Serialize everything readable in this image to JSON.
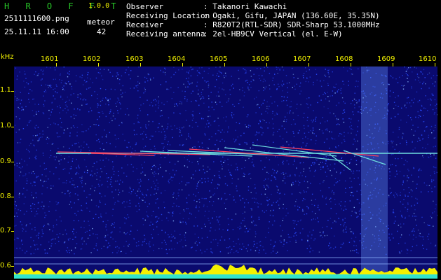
{
  "header": {
    "app_title": "H R O F F T",
    "app_version": "1.0.0",
    "file_name": "2511111600.png",
    "timestamp": "25.11.11 16:00",
    "meteor_label": "meteor",
    "meteor_count": "42",
    "info": [
      {
        "key": "Observer",
        "value": ": Takanori Kawachi"
      },
      {
        "key": "Receiving Location",
        "value": ": Ogaki, Gifu, JAPAN (136.60E, 35.35N)"
      },
      {
        "key": "Receiver",
        "value": ": R820T2(RTL-SDR) SDR-Sharp 53.1000MHz"
      },
      {
        "key": "Receiving antenna",
        "value": ": 2el-HB9CV Vertical (el. E-W)"
      }
    ]
  },
  "axis": {
    "unit": "kHz",
    "time_labels": [
      "1601",
      "1602",
      "1603",
      "1604",
      "1605",
      "1606",
      "1607",
      "1608",
      "1609",
      "1610"
    ],
    "freq_labels": [
      "1.1",
      "1.0",
      "0.9",
      "0.8",
      "0.7",
      "0.6"
    ]
  },
  "colors": {
    "background": "#0a0a6e",
    "noise": "#2a4cff",
    "signal": "#6fe0e0",
    "echo_hot": "#ff4060",
    "activity": "#f5f000",
    "baseline": "#00e0ff"
  }
}
